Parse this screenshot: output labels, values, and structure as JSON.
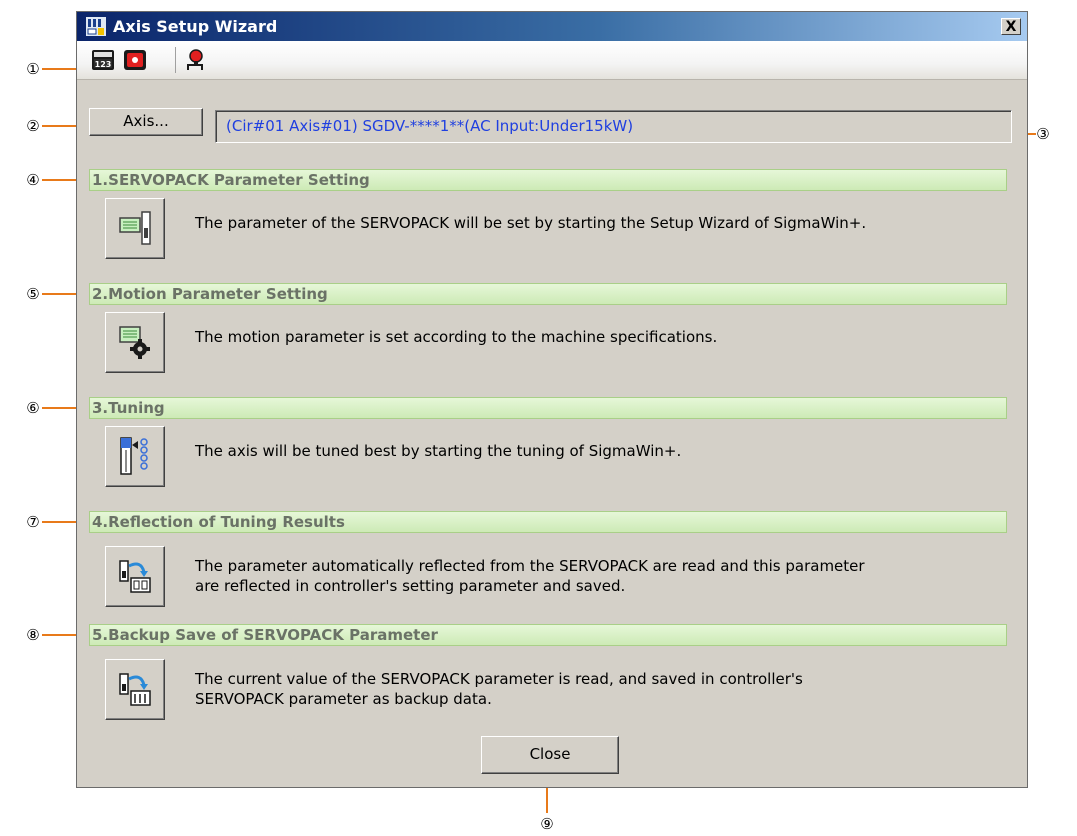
{
  "window": {
    "title": "Axis Setup Wizard",
    "close_glyph": "X"
  },
  "toolbar": {
    "items": [
      {
        "icon": "calculator-icon"
      },
      {
        "icon": "record-icon"
      },
      {
        "icon": "alarm-light-icon"
      }
    ]
  },
  "axis": {
    "button_label": "Axis...",
    "value": "(Cir#01 Axis#01) SGDV-****1**(AC Input:Under15kW)"
  },
  "steps": [
    {
      "title": "1.SERVOPACK Parameter Setting",
      "description": "The parameter of the SERVOPACK will be set by starting the Setup Wizard of SigmaWin+.",
      "icon": "servopack-setup-icon"
    },
    {
      "title": "2.Motion Parameter Setting",
      "description": "The motion parameter is set according to the machine specifications.",
      "icon": "motion-gear-icon"
    },
    {
      "title": "3.Tuning",
      "description": "The axis will be tuned best by starting the tuning of SigmaWin+.",
      "icon": "tuning-icon"
    },
    {
      "title": "4.Reflection of Tuning Results",
      "description": "The parameter automatically reflected from the SERVOPACK are read and this parameter\nare reflected in controller's setting parameter and saved.",
      "icon": "reflect-results-icon"
    },
    {
      "title": "5.Backup Save of SERVOPACK Parameter",
      "description": "The current value of the SERVOPACK parameter is read, and saved in controller's\nSERVOPACK parameter as backup data.",
      "icon": "backup-save-icon"
    }
  ],
  "close_button_label": "Close",
  "callouts": [
    "①",
    "②",
    "③",
    "④",
    "⑤",
    "⑥",
    "⑦",
    "⑧",
    "⑨"
  ],
  "colors": {
    "callout_line": "#e87a1a",
    "axis_text": "#1f3fe0",
    "section_bar": "#cdeab6"
  }
}
